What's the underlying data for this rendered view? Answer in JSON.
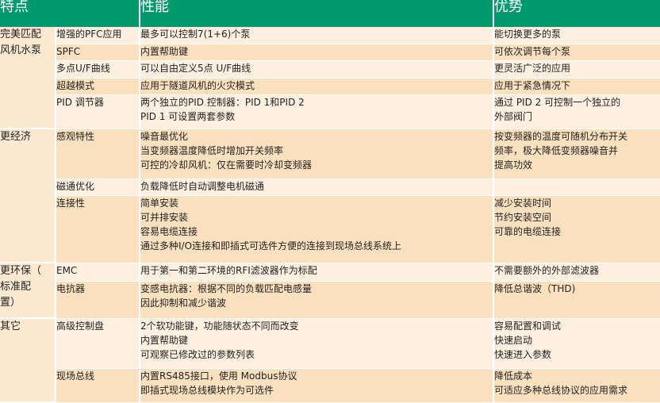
{
  "header": {
    "col1": "特点",
    "col2": "性能",
    "col3": "优势"
  },
  "groups": [
    {
      "label": [
        "完美匹配",
        "风机水泵"
      ],
      "rows": [
        {
          "feature": "增强的PFC应用",
          "performance": [
            "最多可以控制7(1+6)个泵"
          ],
          "advantage": [
            "能切换更多的泵"
          ]
        },
        {
          "feature": "SPFC",
          "performance": [
            "内置帮助键"
          ],
          "advantage": [
            "可依次调节每个泵"
          ]
        },
        {
          "feature": "多点U/F曲线",
          "performance": [
            "可以自由定义5点 U/F曲线"
          ],
          "advantage": [
            "更灵活广泛的应用"
          ]
        },
        {
          "feature": "超越模式",
          "performance": [
            "应用于隧道风机的火灾模式"
          ],
          "advantage": [
            "应用于紧急情况下"
          ]
        },
        {
          "feature": "PID 调节器",
          "performance": [
            "两个独立的PID 控制器：PID 1和PID 2",
            "PID 1 可设置两套参数"
          ],
          "advantage": [
            "通过 PID 2 可控制一个独立的",
            "外部阀门"
          ]
        }
      ]
    },
    {
      "label": [
        "更经济"
      ],
      "rows": [
        {
          "feature": "感观特性",
          "performance": [
            "噪音最优化",
            "当变频器温度降低时增加开关频率",
            "可控的冷却风机：仅在需要时冷却变频器"
          ],
          "advantage": [
            "按变频器的温度可随机分布开关",
            "频率，极大降低变频器噪音并",
            "提高功效"
          ]
        },
        {
          "feature": "磁通优化",
          "performance": [
            "负载降低时自动调整电机磁通"
          ],
          "advantage": []
        },
        {
          "feature": "连接性",
          "performance": [
            "简单安装",
            "可并排安装",
            "容易电缆连接",
            "通过多种I/O连接和即插式可选件方便的连接到现场总线系统上"
          ],
          "advantage": [
            "减少安装时间",
            "节约安装空间",
            "可靠的电缆连接"
          ]
        }
      ]
    },
    {
      "label": [
        "更环保（",
        "标准配",
        "置）"
      ],
      "rows": [
        {
          "feature": "EMC",
          "performance": [
            "用于第一和第二环境的RFI滤波器作为标配"
          ],
          "advantage": [
            "不需要额外的外部滤波器"
          ]
        },
        {
          "feature": "电抗器",
          "performance": [
            "变感电抗器：根据不同的负载匹配电感量",
            "因此抑制和减少谐波"
          ],
          "advantage": [
            "降低总谐波（THD)"
          ]
        }
      ]
    },
    {
      "label": [
        "其它"
      ],
      "rows": [
        {
          "feature": "高级控制盘",
          "performance": [
            "2个软功能键，功能随状态不同而改变",
            "内置帮助键",
            "可观察已修改过的参数列表"
          ],
          "advantage": [
            "容易配置和调试",
            "快速启动",
            "快速进入参数"
          ]
        },
        {
          "feature": "现场总线",
          "performance": [
            "内置RS485接口，使用 Modbus协议",
            "即插式现场总线模块作为可选件"
          ],
          "advantage": [
            "降低成本",
            "可适应多种总线协议的应用需求"
          ]
        }
      ]
    }
  ]
}
